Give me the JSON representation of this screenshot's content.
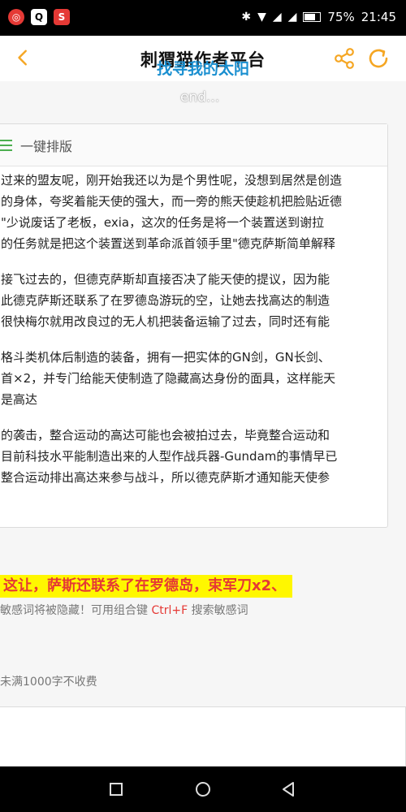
{
  "status_bar": {
    "battery": "75%",
    "time": "21:45",
    "battery_level": 0.75
  },
  "app_bar": {
    "title": "刺猬猫作者平台",
    "overlay_label": "找寻我的太阳",
    "end_label": "end..."
  },
  "editor": {
    "format_button": "一键排版",
    "paragraphs": [
      [
        "过来的盟友呢，刚开始我还以为是个男性呢，没想到居然是创造",
        "的身体，夸奖着能天使的强大，而一旁的熊天使趁机把脸贴近德",
        "\"少说废话了老板，exia，这次的任务是将一个装置送到谢拉",
        "的任务就是把这个装置送到革命派首领手里\"德克萨斯简单解释"
      ],
      [
        "接飞过去的，但德克萨斯却直接否决了能天使的提议，因为能",
        "此德克萨斯还联系了在罗德岛游玩的空，让她去找高达的制造",
        "很快梅尔就用改良过的无人机把装备运输了过去，同时还有能"
      ],
      [
        "格斗类机体后制造的装备，拥有一把实体的GN剑，GN长剑、",
        "首×2，并专门给能天使制造了隐藏高达身份的面具，这样能天",
        "是高达"
      ],
      [
        "的袭击，整合运动的高达可能也会被拍过去，毕竟整合运动和",
        "目前科技水平能制造出来的人型作战兵器-Gundam的事情早已",
        "整合运动排出高达来参与战斗，所以德克萨斯才通知能天使参"
      ]
    ]
  },
  "highlight_text": "这让，萨斯还联系了在罗德岛，束军刀x2、",
  "hint": {
    "prefix": "敏感词将被隐藏！可用组合键",
    "shortcut": "Ctrl+F",
    "suffix": "搜索敏感词"
  },
  "fee_note": "未满1000字不收费",
  "colors": {
    "accent": "#f5a623",
    "highlight_bg": "#fff700",
    "highlight_text": "#e53935",
    "overlay_blue": "#1a8fd0"
  }
}
